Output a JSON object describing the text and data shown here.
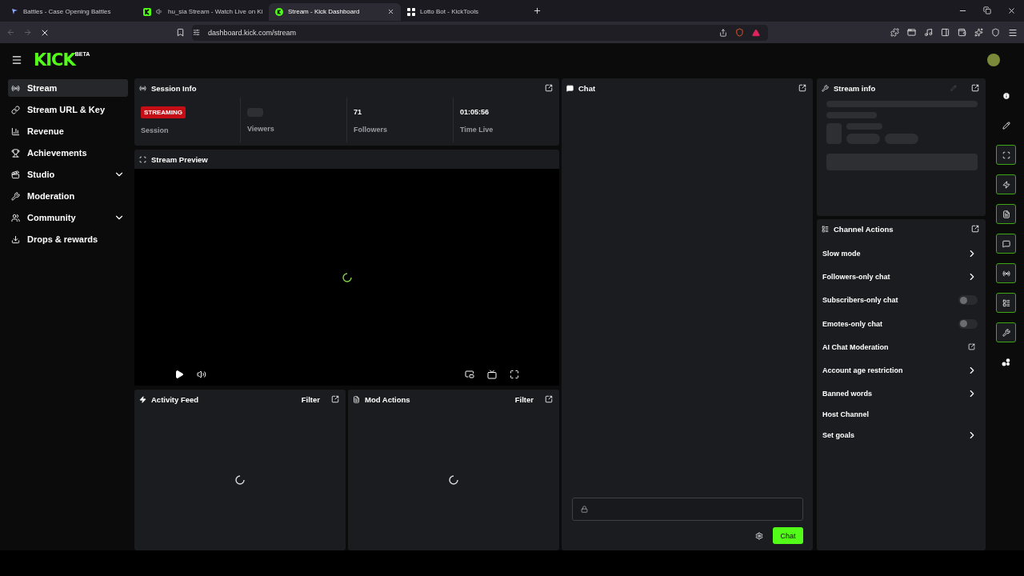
{
  "browser": {
    "tabs": [
      {
        "title": "Battles - Case Opening Battles",
        "selected": false,
        "kind": "battles",
        "audio": false
      },
      {
        "title": "hu_sia Stream - Watch Live on Ki",
        "selected": false,
        "kind": "kick",
        "audio": true
      },
      {
        "title": "Stream - Kick Dashboard",
        "selected": true,
        "kind": "dashboard",
        "audio": false
      },
      {
        "title": "Lotto Bot - KickTools",
        "selected": false,
        "kind": "grid",
        "audio": false
      }
    ],
    "url": "dashboard.kick.com/stream"
  },
  "header": {
    "logo": "KICK",
    "badge": "BETA"
  },
  "sidebar": {
    "items": [
      {
        "label": "Stream",
        "kind": "link",
        "selected": true
      },
      {
        "label": "Stream URL & Key",
        "kind": "link",
        "selected": false
      },
      {
        "label": "Revenue",
        "kind": "link",
        "selected": false
      },
      {
        "label": "Achievements",
        "kind": "link",
        "selected": false
      },
      {
        "label": "Studio",
        "kind": "group",
        "selected": false
      },
      {
        "label": "Moderation",
        "kind": "link",
        "selected": false
      },
      {
        "label": "Community",
        "kind": "group",
        "selected": false
      },
      {
        "label": "Drops & rewards",
        "kind": "link",
        "selected": false
      }
    ]
  },
  "session_info": {
    "title": "Session Info",
    "stats": [
      {
        "kind": "badge",
        "value": "STREAMING",
        "label": "Session"
      },
      {
        "kind": "loading",
        "label": "Viewers"
      },
      {
        "kind": "text",
        "value": "71",
        "label": "Followers"
      },
      {
        "kind": "text",
        "value": "01:05:56",
        "label": "Time Live"
      }
    ]
  },
  "stream_preview": {
    "title": "Stream Preview",
    "loading": true
  },
  "activity_feed": {
    "title": "Activity Feed",
    "filter": "Filter",
    "loading": true
  },
  "mod_actions": {
    "title": "Mod Actions",
    "filter": "Filter",
    "loading": true
  },
  "chat": {
    "title": "Chat",
    "send_button": "Chat"
  },
  "stream_info": {
    "title": "Stream info",
    "loading": true
  },
  "channel_actions": {
    "title": "Channel Actions",
    "items": [
      {
        "label": "Slow mode",
        "kind": "arrow"
      },
      {
        "label": "Followers-only chat",
        "kind": "arrow"
      },
      {
        "label": "Subscribers-only chat",
        "kind": "toggle",
        "on": false
      },
      {
        "label": "Emotes-only chat",
        "kind": "toggle",
        "on": false
      },
      {
        "label": "AI Chat Moderation",
        "kind": "external"
      },
      {
        "label": "Account age restriction",
        "kind": "arrow"
      },
      {
        "label": "Banned words",
        "kind": "arrow"
      },
      {
        "label": "Host Channel",
        "kind": "plain"
      },
      {
        "label": "Set goals",
        "kind": "arrow"
      }
    ]
  },
  "rail": [
    {
      "active": false
    },
    {
      "active": false
    },
    {
      "active": true
    },
    {
      "active": true
    },
    {
      "active": true
    },
    {
      "active": true
    },
    {
      "active": true
    },
    {
      "active": true
    },
    {
      "active": true
    },
    {
      "active": false
    }
  ]
}
